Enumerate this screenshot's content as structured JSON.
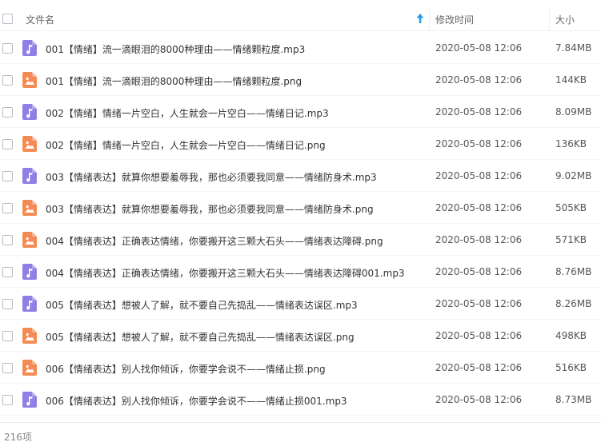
{
  "header": {
    "name_label": "文件名",
    "mtime_label": "修改时间",
    "size_label": "大小"
  },
  "colors": {
    "audio_icon": "#8f7fe6",
    "image_icon": "#f68a54",
    "sort_arrow": "#2c9ae8"
  },
  "files": [
    {
      "name": "001【情绪】流一滴眼泪的8000种理由——情绪颗粒度.mp3",
      "mtime": "2020-05-08 12:06",
      "size": "7.84MB",
      "icon": "audio-file-icon"
    },
    {
      "name": "001【情绪】流一滴眼泪的8000种理由——情绪颗粒度.png",
      "mtime": "2020-05-08 12:06",
      "size": "144KB",
      "icon": "image-file-icon"
    },
    {
      "name": "002【情绪】情绪一片空白，人生就会一片空白——情绪日记.mp3",
      "mtime": "2020-05-08 12:06",
      "size": "8.09MB",
      "icon": "audio-file-icon"
    },
    {
      "name": "002【情绪】情绪一片空白，人生就会一片空白——情绪日记.png",
      "mtime": "2020-05-08 12:06",
      "size": "136KB",
      "icon": "image-file-icon"
    },
    {
      "name": "003【情绪表达】就算你想要羞辱我，那也必须要我同意——情绪防身术.mp3",
      "mtime": "2020-05-08 12:06",
      "size": "9.02MB",
      "icon": "audio-file-icon"
    },
    {
      "name": "003【情绪表达】就算你想要羞辱我，那也必须要我同意——情绪防身术.png",
      "mtime": "2020-05-08 12:06",
      "size": "505KB",
      "icon": "image-file-icon"
    },
    {
      "name": "004【情绪表达】正确表达情绪，你要搬开这三颗大石头——情绪表达障碍.png",
      "mtime": "2020-05-08 12:06",
      "size": "571KB",
      "icon": "image-file-icon"
    },
    {
      "name": "004【情绪表达】正确表达情绪，你要搬开这三颗大石头——情绪表达障碍001.mp3",
      "mtime": "2020-05-08 12:06",
      "size": "8.76MB",
      "icon": "audio-file-icon"
    },
    {
      "name": "005【情绪表达】想被人了解，就不要自己先捣乱——情绪表达误区.mp3",
      "mtime": "2020-05-08 12:06",
      "size": "8.26MB",
      "icon": "audio-file-icon"
    },
    {
      "name": "005【情绪表达】想被人了解，就不要自己先捣乱——情绪表达误区.png",
      "mtime": "2020-05-08 12:06",
      "size": "498KB",
      "icon": "image-file-icon"
    },
    {
      "name": "006【情绪表达】别人找你倾诉，你要学会说不——情绪止损.png",
      "mtime": "2020-05-08 12:06",
      "size": "516KB",
      "icon": "image-file-icon"
    },
    {
      "name": "006【情绪表达】别人找你倾诉，你要学会说不——情绪止损001.mp3",
      "mtime": "2020-05-08 12:06",
      "size": "8.73MB",
      "icon": "audio-file-icon"
    }
  ],
  "footer": {
    "count": "216项"
  }
}
